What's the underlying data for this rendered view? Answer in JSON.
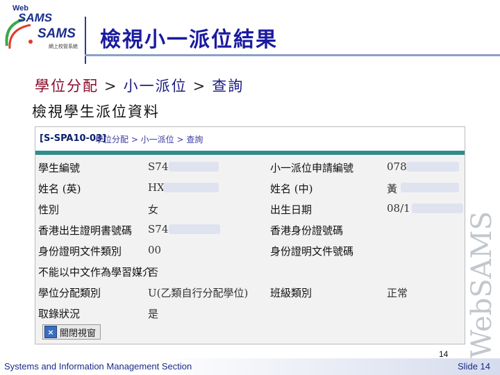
{
  "logo": {
    "web": "Web",
    "sams_top": "SAMS",
    "sams_bottom": "SAMS",
    "tagline": "網上校管系統"
  },
  "title": "檢視小一派位結果",
  "breadcrumb": {
    "part1": "學位分配",
    "sep1": ">",
    "part2": "小一派位",
    "sep2": ">",
    "part3": "查詢"
  },
  "subtitle": "檢視學生派位資料",
  "panel": {
    "code": "[S-SPA10-03]",
    "path": "學位分配 > 小一派位 > 查詢",
    "rows": [
      {
        "label_left": "學生編號",
        "value_left": "S74",
        "label_right": "小一派位申請編號",
        "value_right": "078"
      },
      {
        "label_left": "姓名 (英)",
        "value_left": "HX",
        "label_right": "姓名 (中)",
        "value_right": "黃"
      },
      {
        "label_left": "性別",
        "value_left": "女",
        "label_right": "出生日期",
        "value_right": "08/1"
      },
      {
        "label_left": "香港出生證明書號碼",
        "value_left": "S74",
        "label_right": "香港身份證號碼",
        "value_right": ""
      },
      {
        "label_left": "身份證明文件類別",
        "value_left": "00",
        "label_right": "身份證明文件號碼",
        "value_right": ""
      },
      {
        "label_left": "不能以中文作為學習媒介",
        "value_left": "否",
        "label_right": "",
        "value_right": ""
      },
      {
        "label_left": "學位分配類別",
        "value_left": "U(乙類自行分配學位)",
        "label_right": "班級類別",
        "value_right": "正常"
      },
      {
        "label_left": "取錄狀況",
        "value_left": "是",
        "label_right": "",
        "value_right": ""
      }
    ],
    "close_button": "關閉視窗"
  },
  "watermark": "WebSAMS",
  "page_number": "14",
  "footer": {
    "section": "Systems and Information Management Section",
    "slide": "Slide 14"
  }
}
